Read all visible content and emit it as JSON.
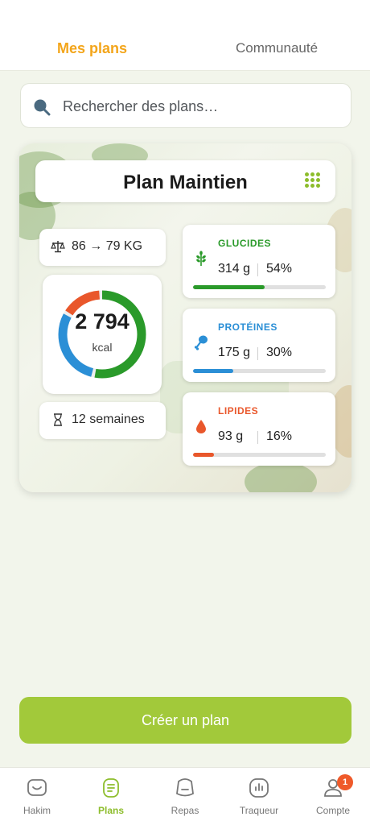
{
  "top_tabs": {
    "active": "Mes plans",
    "inactive": "Communauté"
  },
  "search": {
    "placeholder": "Rechercher des plans…"
  },
  "plan": {
    "title": "Plan Maintien",
    "weight": "86 → 79 KG",
    "calories": {
      "value": "2 794",
      "unit": "kcal"
    },
    "duration": "12 semaines",
    "macros": [
      {
        "label": "GLUCIDES",
        "grams": "314 g",
        "percent": "54%",
        "fraction": 0.54,
        "color": "#2a9a2a",
        "icon": "wheat-icon"
      },
      {
        "label": "PROTÉINES",
        "grams": "175 g",
        "percent": "30%",
        "fraction": 0.3,
        "color": "#2b8fd6",
        "icon": "drumstick-icon"
      },
      {
        "label": "LIPIDES",
        "grams": "93 g",
        "percent": "16%",
        "fraction": 0.16,
        "color": "#e9572b",
        "icon": "drop-icon"
      }
    ]
  },
  "create_button": {
    "label": "Créer un plan"
  },
  "bottom_nav": {
    "items": [
      {
        "label": "Hakim"
      },
      {
        "label": "Plans"
      },
      {
        "label": "Repas"
      },
      {
        "label": "Traqueur"
      },
      {
        "label": "Compte",
        "badge": "1"
      }
    ]
  }
}
